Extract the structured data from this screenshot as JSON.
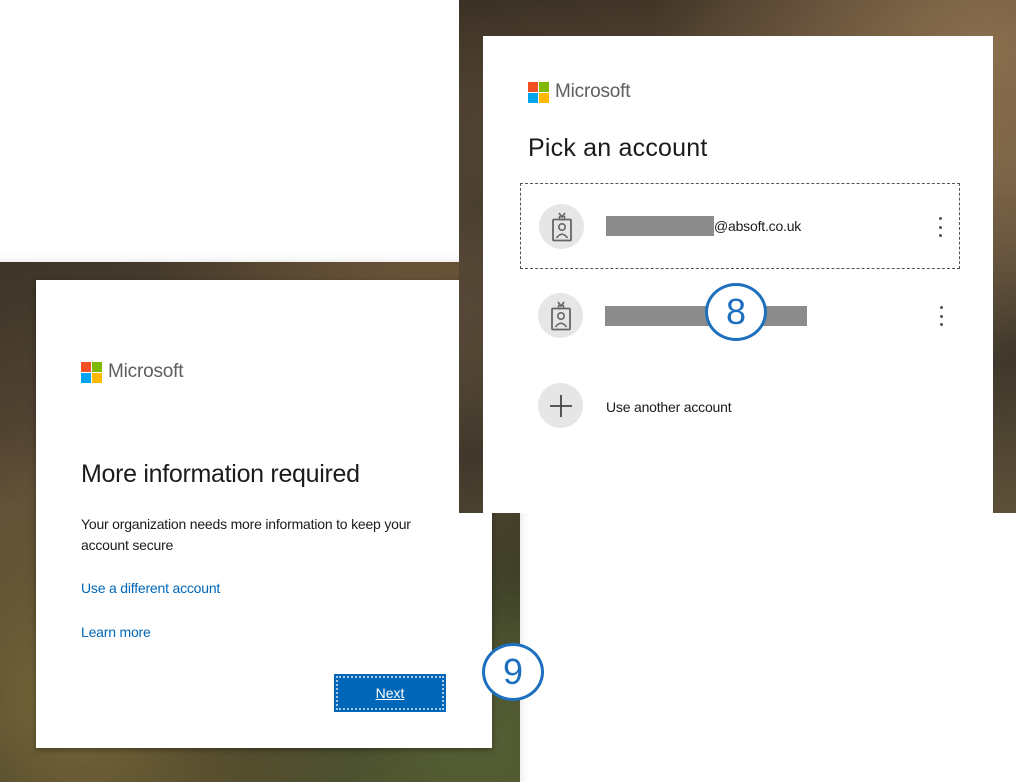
{
  "brand": {
    "name": "Microsoft",
    "colors": {
      "red": "#f25022",
      "green": "#7fba00",
      "blue": "#00a4ef",
      "yellow": "#ffb900"
    },
    "link_color": "#0067b8",
    "button_color": "#0067b8"
  },
  "more_info_dialog": {
    "title": "More information required",
    "description": "Your organization needs more information to keep your account secure",
    "use_different_account_link": "Use a different account",
    "learn_more_link": "Learn more",
    "next_button": "Next"
  },
  "pick_account_dialog": {
    "title": "Pick an account",
    "accounts": [
      {
        "email_suffix": "@absoft.co.uk",
        "avatar_icon": "badge-user-icon",
        "selected": true
      },
      {
        "email_suffix": "",
        "avatar_icon": "badge-user-icon",
        "selected": false
      }
    ],
    "use_another_account": "Use another account",
    "add_icon": "plus-icon"
  },
  "step_markers": {
    "pick_account": "8",
    "next": "9"
  }
}
